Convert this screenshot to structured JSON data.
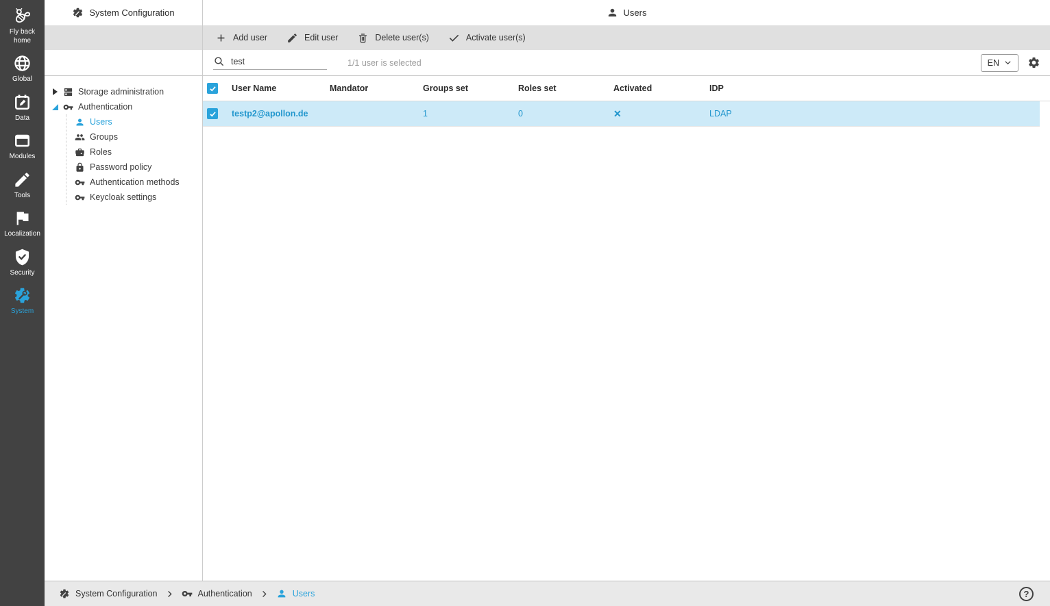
{
  "sidebar": {
    "items": [
      {
        "label": "Fly back home",
        "icon": "bee-icon",
        "active": false
      },
      {
        "label": "Global",
        "icon": "globe-icon",
        "active": false
      },
      {
        "label": "Data",
        "icon": "calendar-edit-icon",
        "active": false
      },
      {
        "label": "Modules",
        "icon": "modules-box-icon",
        "active": false
      },
      {
        "label": "Tools",
        "icon": "pencil-icon",
        "active": false
      },
      {
        "label": "Localization",
        "icon": "flag-icon",
        "active": false
      },
      {
        "label": "Security",
        "icon": "shield-check-icon",
        "active": false
      },
      {
        "label": "System",
        "icon": "gear-wrench-icon",
        "active": true
      }
    ]
  },
  "panel": {
    "title": "System Configuration",
    "tree": [
      {
        "label": "Storage administration",
        "state": "collapsed",
        "icon": "storage-icon"
      },
      {
        "label": "Authentication",
        "state": "expanded",
        "icon": "key-icon",
        "children": [
          {
            "label": "Users",
            "icon": "person-icon",
            "selected": true
          },
          {
            "label": "Groups",
            "icon": "group-icon",
            "selected": false
          },
          {
            "label": "Roles",
            "icon": "briefcase-icon",
            "selected": false
          },
          {
            "label": "Password policy",
            "icon": "lock-icon",
            "selected": false
          },
          {
            "label": "Authentication methods",
            "icon": "key-icon",
            "selected": false
          },
          {
            "label": "Keycloak settings",
            "icon": "key-icon",
            "selected": false
          }
        ]
      }
    ]
  },
  "header": {
    "title": "Users"
  },
  "toolbar": {
    "buttons": [
      {
        "label": "Add user",
        "icon": "plus-icon"
      },
      {
        "label": "Edit user",
        "icon": "pencil-icon"
      },
      {
        "label": "Delete user(s)",
        "icon": "trash-icon"
      },
      {
        "label": "Activate user(s)",
        "icon": "check-icon"
      }
    ]
  },
  "search": {
    "value": "test",
    "status": "1/1 user is selected",
    "language": "EN"
  },
  "table": {
    "columns": [
      "User Name",
      "Mandator",
      "Groups set",
      "Roles set",
      "Activated",
      "IDP"
    ],
    "rows": [
      {
        "selected": true,
        "user_name": "testp2@apollon.de",
        "mandator": "",
        "groups_set": "1",
        "roles_set": "0",
        "activated": false,
        "activated_glyph": "✕",
        "idp": "LDAP"
      }
    ]
  },
  "breadcrumb": {
    "items": [
      {
        "label": "System Configuration",
        "icon": "gear-wrench-icon",
        "active": false
      },
      {
        "label": "Authentication",
        "icon": "key-icon",
        "active": false
      },
      {
        "label": "Users",
        "icon": "person-icon",
        "active": true
      }
    ]
  },
  "help": {
    "glyph": "?"
  },
  "colors": {
    "accent": "#2aa3db",
    "selected_row_bg": "#cdeaf8",
    "rail_bg": "#424242",
    "toolbar_bg": "#e0e0e0"
  }
}
